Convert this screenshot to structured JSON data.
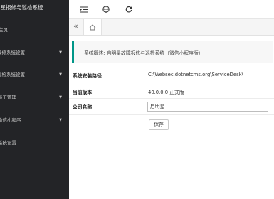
{
  "sidebar": {
    "app_title": "明星报修与巡检系统",
    "items": [
      {
        "label": "主页",
        "has_children": false
      },
      {
        "label": "报修系统设置",
        "has_children": true
      },
      {
        "label": "巡检系统设置",
        "has_children": true
      },
      {
        "label": "员工管理",
        "has_children": true
      },
      {
        "label": "微信小程序",
        "has_children": true
      },
      {
        "label": "系统设置",
        "has_children": false
      }
    ]
  },
  "toolbar": {
    "icons": [
      "menu-toggle-icon",
      "globe-icon",
      "refresh-icon"
    ]
  },
  "tabs": {
    "back_icon": "double-chevron-left-icon",
    "home_icon": "home-icon"
  },
  "main": {
    "notice": "系统概述: 启明星故障报修与巡检系统（微信小程序版）",
    "fields": [
      {
        "label": "系统安装路径",
        "value": "C:\\Websec.dotnetcms.org\\ServiceDesk\\"
      },
      {
        "label": "当前版本",
        "value": "40.0.0.0 正式版"
      },
      {
        "label": "公司名称",
        "value": "启明星"
      }
    ],
    "save_label": "保存"
  },
  "colors": {
    "sidebar_bg": "#232427",
    "accent": "#009688"
  }
}
